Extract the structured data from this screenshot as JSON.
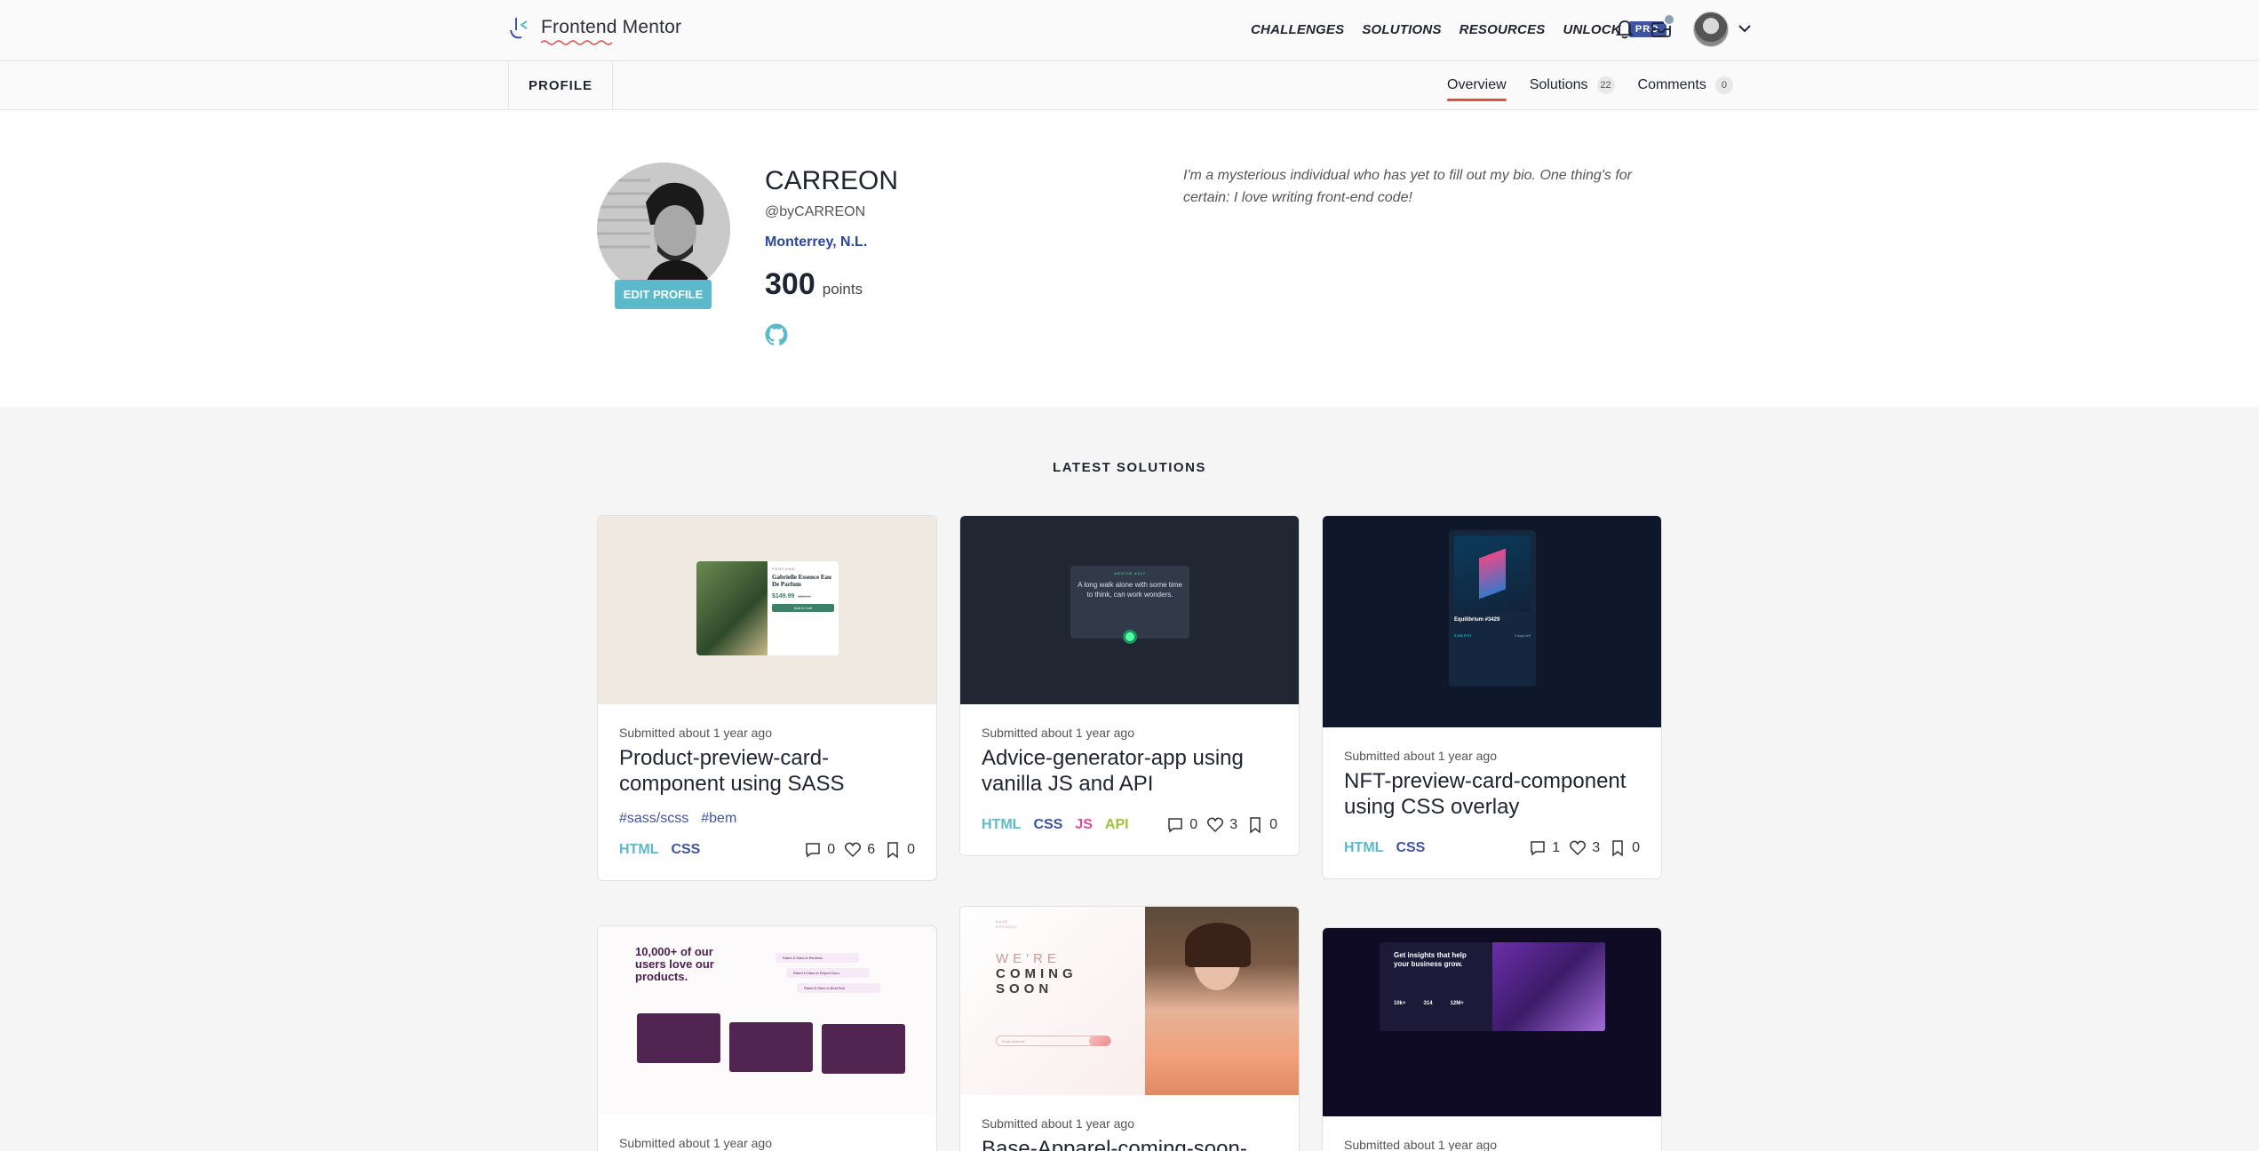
{
  "nav": {
    "logo_text": "Frontend Mentor",
    "links": [
      "CHALLENGES",
      "SOLUTIONS",
      "RESOURCES",
      "UNLOCK"
    ],
    "pro_badge": "PRO",
    "icons": [
      "bell-icon",
      "inbox-icon",
      "user-avatar",
      "chevron-down-icon"
    ]
  },
  "subnav": {
    "profile_tab": "PROFILE",
    "tabs": [
      {
        "label": "Overview",
        "count": null,
        "active": true
      },
      {
        "label": "Solutions",
        "count": "22"
      },
      {
        "label": "Comments",
        "count": "0"
      }
    ]
  },
  "profile": {
    "name": "CARREON",
    "handle": "@byCARREON",
    "location": "Monterrey, N.L.",
    "points": "300",
    "points_label": "points",
    "edit_button": "EDIT PROFILE",
    "bio": "I'm a mysterious individual who has yet to fill out my bio. One thing's for certain: I love writing front-end code!"
  },
  "solutions": {
    "title": "LATEST SOLUTIONS",
    "cards": [
      {
        "submitted": "Submitted about 1 year ago",
        "title": "Product-preview-card-component using SASS",
        "tags": [
          "#sass/scss",
          "#bem"
        ],
        "langs": [
          "HTML",
          "CSS"
        ],
        "comments": "0",
        "likes": "6",
        "bookmarks": "0",
        "thumb": {
          "card_title": "Gabrielle Essence Eau De Parfum",
          "price": "$149.99",
          "old_price": "$169.99",
          "cta": "Add to Cart",
          "kicker": "PERFUME"
        }
      },
      {
        "submitted": "Submitted about 1 year ago",
        "title": "Advice-generator-app using vanilla JS and API",
        "tags": [],
        "langs": [
          "HTML",
          "CSS",
          "JS",
          "API"
        ],
        "comments": "0",
        "likes": "3",
        "bookmarks": "0",
        "thumb": {
          "quote": "A long walk alone with some time to think, can work wonders.",
          "kicker": "ADVICE #117"
        }
      },
      {
        "submitted": "Submitted about 1 year ago",
        "title": "NFT-preview-card-component using CSS overlay",
        "tags": [],
        "langs": [
          "HTML",
          "CSS"
        ],
        "comments": "1",
        "likes": "3",
        "bookmarks": "0",
        "thumb": {
          "nft_name": "Equilibrium #3429",
          "eth": "0.041 ETH",
          "days": "3 days left"
        }
      },
      {
        "submitted": "Submitted about 1 year ago",
        "thumb": {
          "headline": "10,000+ of our users love our products.",
          "ratings": [
            "Rated 5 Stars in Reviews",
            "Rated 5 Stars in Report Guru",
            "Rated 5 Stars in BestTech"
          ]
        }
      },
      {
        "submitted": "Submitted about 1 year ago",
        "title": "Base-Apparel-coming-soon-",
        "thumb": {
          "brand": "BASE APPAREL",
          "headline_1": "WE'RE",
          "headline_2": "COMING",
          "headline_3": "SOON",
          "email_placeholder": "Email Address"
        }
      },
      {
        "submitted": "Submitted about 1 year ago",
        "thumb": {
          "headline": "Get insights that help your business grow.",
          "stats": [
            "10k+",
            "314",
            "12M+"
          ]
        }
      }
    ]
  },
  "colors": {
    "accent_red": "#e24c4b",
    "brand_blue": "#3e54a3",
    "teal": "#5cb9c9",
    "section_bg": "#f5f5f5"
  }
}
